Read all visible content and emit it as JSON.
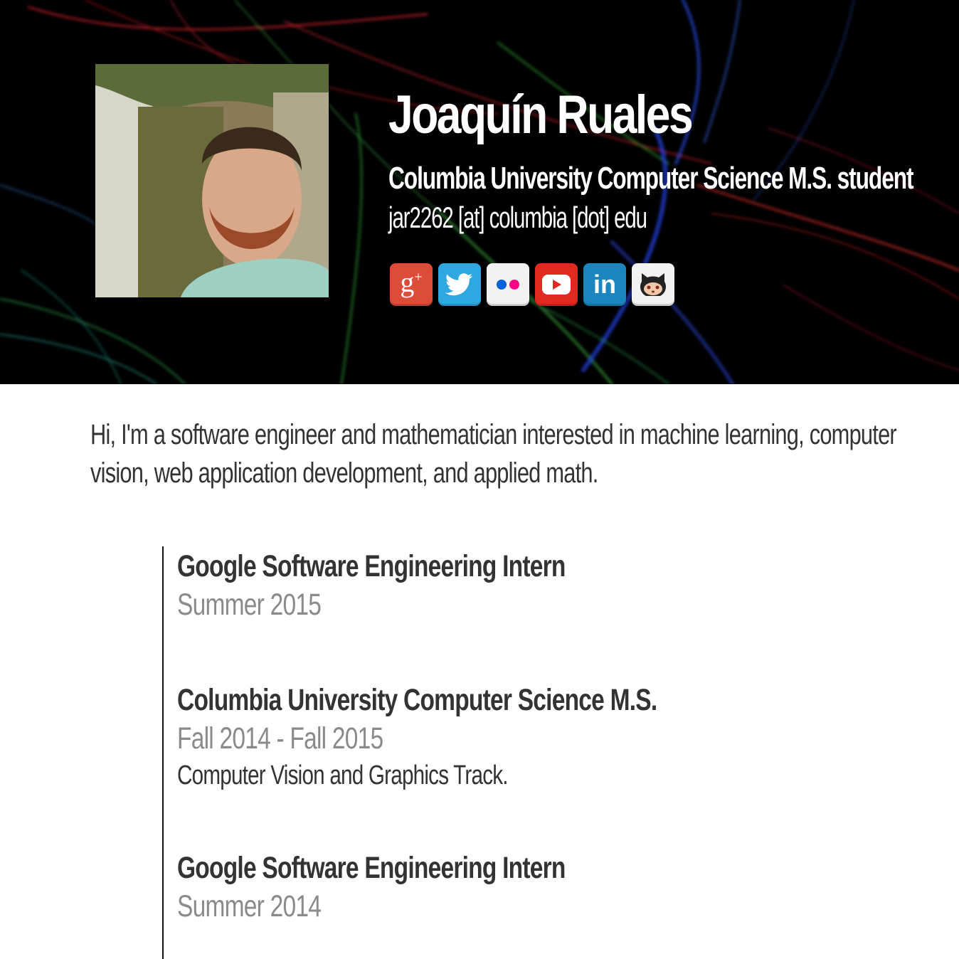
{
  "profile": {
    "name": "Joaquín Ruales",
    "subtitle": "Columbia University Computer Science M.S. student",
    "email": "jar2262 [at] columbia [dot] edu",
    "photo_alt": "Profile photo"
  },
  "social": [
    {
      "icon": "google-plus-icon",
      "glyph": "g⁺",
      "color": "#dd4b39"
    },
    {
      "icon": "twitter-icon",
      "glyph": "",
      "color": "#2fa8e0"
    },
    {
      "icon": "flickr-icon",
      "glyph": "",
      "color": "#f2f2f2"
    },
    {
      "icon": "youtube-icon",
      "glyph": "",
      "color": "#e02a20"
    },
    {
      "icon": "linkedin-icon",
      "glyph": "in",
      "color": "#1b86bd"
    },
    {
      "icon": "github-icon",
      "glyph": "",
      "color": "#f2f2f2"
    }
  ],
  "intro": "Hi, I'm a software engineer and mathematician interested in machine learning, computer vision, web application development, and applied math.",
  "timeline": [
    {
      "title": "Google Software Engineering Intern",
      "date": "Summer 2015",
      "desc": ""
    },
    {
      "title": "Columbia University Computer Science M.S.",
      "date": "Fall 2014 - Fall 2015",
      "desc": "Computer Vision and Graphics Track."
    },
    {
      "title": "Google Software Engineering Intern",
      "date": "Summer 2014",
      "desc": ""
    }
  ],
  "colors": {
    "header_bg": "#000000",
    "text_dark": "#333333",
    "text_muted": "#8a8a8a"
  }
}
